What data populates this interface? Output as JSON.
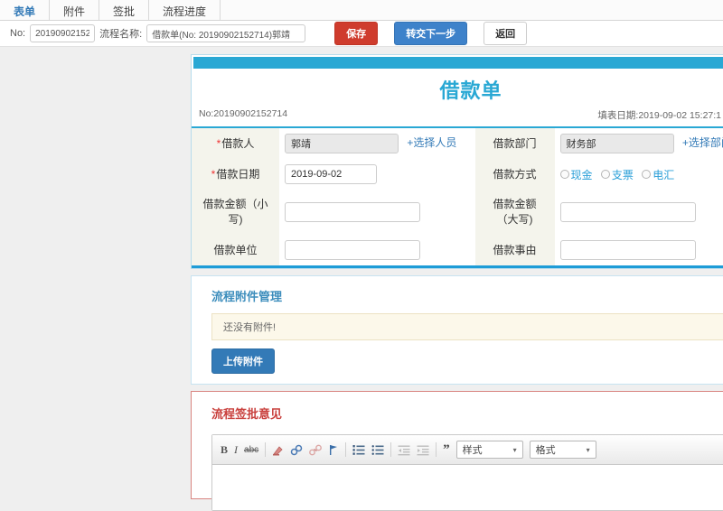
{
  "colors": {
    "accent_blue": "#29a8d4",
    "section_blue": "#3c8dbc",
    "save_red": "#cf3c2d",
    "next_blue": "#3e82ca",
    "upload_blue": "#337ab7",
    "section_red": "#c9403d",
    "link_blue": "#337ab7",
    "label_bg": "#f4f4ec",
    "warning_bg": "#fcf8ea"
  },
  "tabs": {
    "form": "表单",
    "attachment": "附件",
    "approve": "签批",
    "progress": "流程进度"
  },
  "toolbar": {
    "no_label": "No:",
    "no_value": "20190902152714",
    "name_label": "流程名称:",
    "name_value": "借款单(No: 20190902152714)郭靖",
    "save": "保存",
    "next": "转交下一步",
    "back": "返回"
  },
  "doc": {
    "title": "借款单",
    "no": "No:20190902152714",
    "fill_date": "填表日期:2019-09-02 15:27:1",
    "required_mark": "*"
  },
  "fields": {
    "borrower": {
      "label": "借款人",
      "value": "郭靖",
      "action": "+选择人员"
    },
    "department": {
      "label": "借款部门",
      "value": "财务部",
      "action": "+选择部门"
    },
    "date": {
      "label": "借款日期",
      "value": "2019-09-02"
    },
    "method": {
      "label": "借款方式",
      "options": [
        "现金",
        "支票",
        "电汇"
      ]
    },
    "amount_small": {
      "label": "借款金额（小写)",
      "value": ""
    },
    "amount_big": {
      "label": "借款金额（大写)",
      "value": ""
    },
    "unit": {
      "label": "借款单位",
      "value": ""
    },
    "reason": {
      "label": "借款事由",
      "value": ""
    }
  },
  "attachments": {
    "title": "流程附件管理",
    "empty": "还没有附件!",
    "upload": "上传附件"
  },
  "approval": {
    "title": "流程签批意见"
  },
  "editor": {
    "bold": "B",
    "italic": "I",
    "strike": "abc",
    "quote": "”",
    "style_dropdown": "样式",
    "format_dropdown": "格式",
    "caret": "▾"
  }
}
